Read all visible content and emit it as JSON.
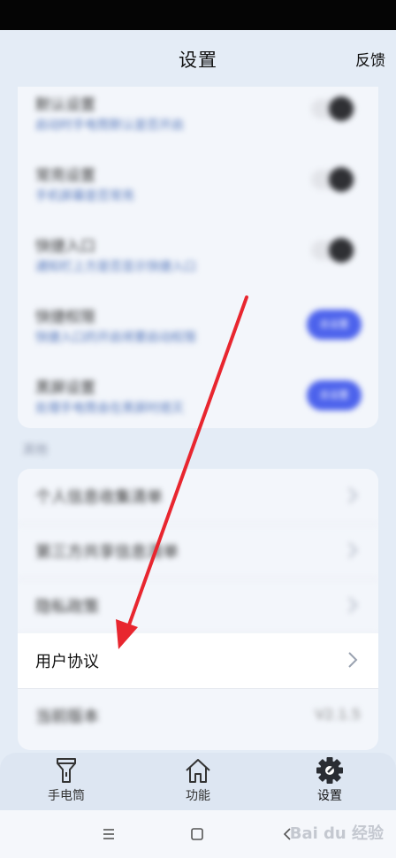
{
  "header": {
    "title": "设置",
    "feedback": "反馈"
  },
  "settings_blurred": [
    {
      "title": "默认设置",
      "subtitle": "启动时手电筒默认是否开启",
      "control": "toggle"
    },
    {
      "title": "常亮设置",
      "subtitle": "手机屏幕是否常亮",
      "control": "toggle"
    },
    {
      "title": "快捷入口",
      "subtitle": "通知栏上方是否显示快捷入口",
      "control": "toggle"
    },
    {
      "title": "快捷权限",
      "subtitle": "快捷入口的开启将要启动权限",
      "control": "button",
      "button_label": "去设置"
    },
    {
      "title": "黑屏设置",
      "subtitle": "处理手电筒会在黑屏时熄灭",
      "control": "button",
      "button_label": "去设置"
    }
  ],
  "section_label": "其他",
  "list": [
    {
      "label": "个人信息收集清单",
      "blurred": true
    },
    {
      "label": "第三方共享信息清单",
      "blurred": true
    },
    {
      "label": "隐私政策",
      "blurred": true
    },
    {
      "label": "用户协议",
      "blurred": false
    },
    {
      "label": "当前版本",
      "value": "V2.1.5",
      "blurred": true
    }
  ],
  "tabs": [
    {
      "label": "手电筒",
      "icon": "flashlight-icon"
    },
    {
      "label": "功能",
      "icon": "home-icon"
    },
    {
      "label": "设置",
      "icon": "gear-icon",
      "active": true
    }
  ],
  "watermark": "Bai du 经验",
  "colors": {
    "accent": "#4c62ec",
    "arrow": "#e8262f",
    "background": "#e4ecf6"
  }
}
